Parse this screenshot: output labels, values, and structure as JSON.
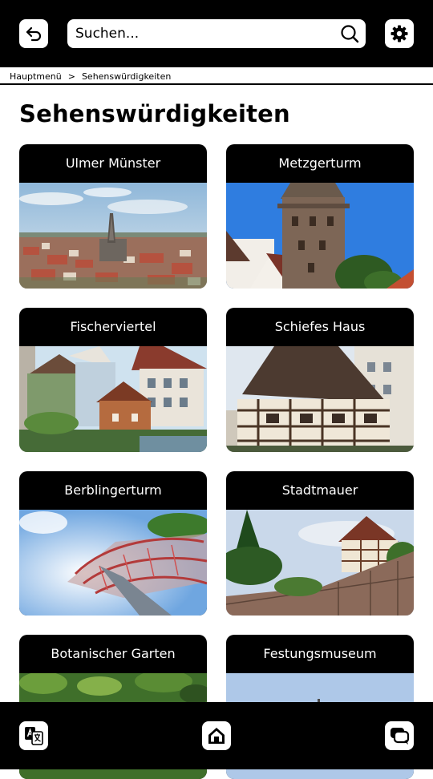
{
  "header": {
    "search_placeholder": "Suchen...",
    "back_icon": "back-arrow-icon",
    "settings_icon": "gear-icon",
    "search_icon": "search-icon"
  },
  "breadcrumb": {
    "home": "Hauptmenü",
    "separator": ">",
    "current": "Sehenswürdigkeiten"
  },
  "page": {
    "title": "Sehenswürdigkeiten"
  },
  "cards": [
    {
      "label": "Ulmer Münster"
    },
    {
      "label": "Metzgerturm"
    },
    {
      "label": "Fischerviertel"
    },
    {
      "label": "Schiefes Haus"
    },
    {
      "label": "Berblingerturm"
    },
    {
      "label": "Stadtmauer"
    },
    {
      "label": "Botanischer Garten"
    },
    {
      "label": "Festungsmuseum"
    }
  ],
  "footer": {
    "translate_icon": "translate-icon",
    "home_icon": "home-icon",
    "chat_icon": "chat-icon"
  },
  "colors": {
    "bar": "#000000",
    "background": "#ffffff",
    "button": "#ffffff"
  }
}
